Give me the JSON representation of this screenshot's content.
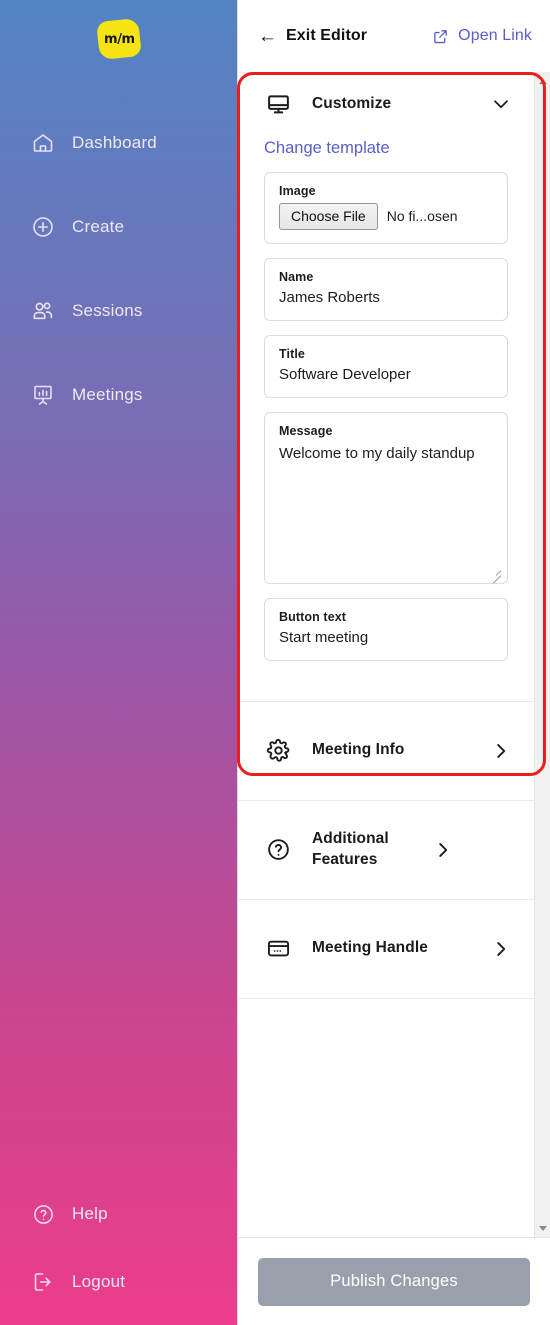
{
  "brand": {
    "logo_text": "m/m",
    "logo_color": "#f5e312"
  },
  "sidebar": {
    "items": [
      {
        "label": "Dashboard",
        "icon": "home-icon"
      },
      {
        "label": "Create",
        "icon": "plus-circle-icon"
      },
      {
        "label": "Sessions",
        "icon": "users-icon"
      },
      {
        "label": "Meetings",
        "icon": "presentation-chart-icon"
      }
    ],
    "bottom_items": [
      {
        "label": "Help",
        "icon": "question-circle-icon"
      },
      {
        "label": "Logout",
        "icon": "logout-icon"
      }
    ]
  },
  "topbar": {
    "exit_label": "Exit Editor",
    "exit_icon": "arrow-left-icon",
    "open_link_label": "Open Link",
    "open_link_icon": "external-link-icon",
    "open_link_color": "#5a5fc7"
  },
  "panel": {
    "customize": {
      "title": "Customize",
      "icon": "desktop-monitor-icon",
      "chevron": "chevron-down-icon",
      "change_template_label": "Change template",
      "fields": {
        "image": {
          "label": "Image",
          "choose_file_label": "Choose File",
          "file_status": "No fi...osen"
        },
        "name": {
          "label": "Name",
          "value": "James Roberts",
          "placeholder": "Name"
        },
        "title": {
          "label": "Title",
          "value": "Software Developer",
          "placeholder": "Title"
        },
        "message": {
          "label": "Message",
          "value": "Welcome to my daily standup",
          "placeholder": "Message"
        },
        "button_text": {
          "label": "Button text",
          "value": "Start meeting",
          "placeholder": "Button text"
        }
      }
    },
    "sections": [
      {
        "title": "Meeting Info",
        "icon": "gear-icon",
        "chevron": "chevron-right-icon"
      },
      {
        "title": "Additional Features",
        "icon": "question-circle-icon",
        "chevron": "chevron-right-icon"
      },
      {
        "title": "Meeting Handle",
        "icon": "card-icon",
        "chevron": "chevron-right-icon"
      }
    ]
  },
  "footer": {
    "publish_label": "Publish Changes",
    "publish_color": "#9aa0ab"
  },
  "annotation": {
    "color": "#e81f1f"
  }
}
